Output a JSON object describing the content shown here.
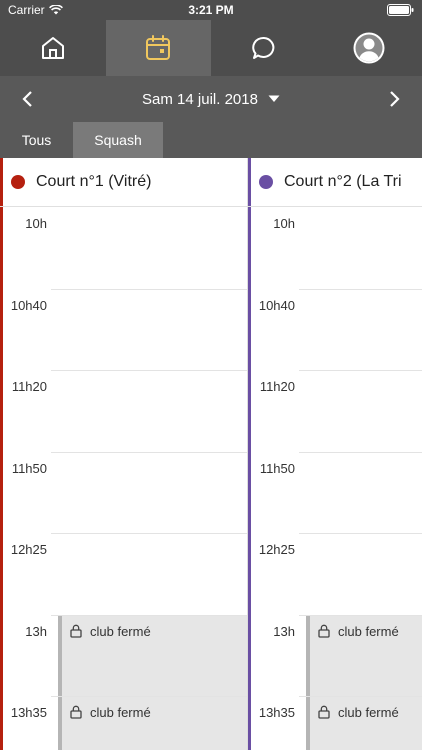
{
  "status_bar": {
    "carrier": "Carrier",
    "time": "3:21 PM"
  },
  "nav": {
    "tabs": [
      {
        "icon": "home-icon"
      },
      {
        "icon": "calendar-icon",
        "active": true
      },
      {
        "icon": "chat-icon"
      },
      {
        "icon": "profile-icon"
      }
    ]
  },
  "date_bar": {
    "date": "Sam 14 juil. 2018"
  },
  "filters": {
    "all_label": "Tous",
    "squash_label": "Squash",
    "selected": "Squash"
  },
  "courts": [
    {
      "name": "Court n°1 (Vitré)",
      "color": "#b5200f",
      "slots": [
        {
          "time": "10h",
          "status": ""
        },
        {
          "time": "10h40",
          "status": ""
        },
        {
          "time": "11h20",
          "status": ""
        },
        {
          "time": "11h50",
          "status": ""
        },
        {
          "time": "12h25",
          "status": ""
        },
        {
          "time": "13h",
          "status": "club fermé"
        },
        {
          "time": "13h35",
          "status": "club fermé"
        }
      ]
    },
    {
      "name": "Court n°2 (La Tri",
      "color": "#6a4fa3",
      "slots": [
        {
          "time": "10h",
          "status": ""
        },
        {
          "time": "10h40",
          "status": ""
        },
        {
          "time": "11h20",
          "status": ""
        },
        {
          "time": "11h50",
          "status": ""
        },
        {
          "time": "12h25",
          "status": ""
        },
        {
          "time": "13h",
          "status": "club fermé"
        },
        {
          "time": "13h35",
          "status": "club fermé"
        }
      ]
    }
  ],
  "colors": {
    "active_icon": "#f0c75e",
    "nav_background": "#4d4d4d"
  }
}
